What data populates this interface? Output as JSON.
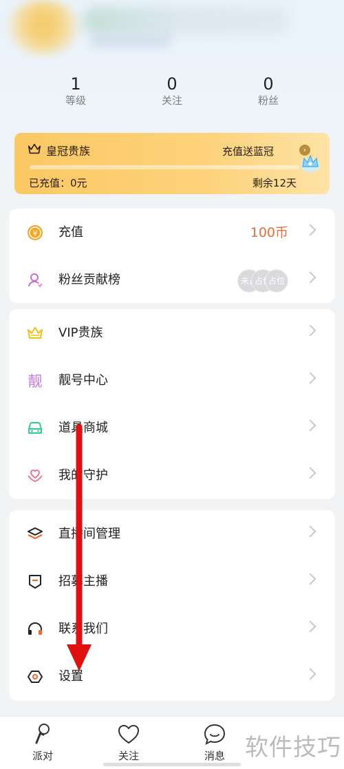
{
  "stats": [
    {
      "value": "1",
      "label": "等级"
    },
    {
      "value": "0",
      "label": "关注"
    },
    {
      "value": "0",
      "label": "粉丝"
    }
  ],
  "vip_card": {
    "title": "皇冠贵族",
    "promo": "充值送蓝冠",
    "paid": "已充值：0元",
    "remaining": "剩余12天",
    "progress": 0
  },
  "menu_group_1": [
    {
      "label": "充值",
      "value": "100币",
      "icon": "yen-coin-icon"
    },
    {
      "label": "粉丝贡献榜",
      "icon": "fan-user-icon",
      "avatar_texts": [
        "未占",
        "占位",
        "占位"
      ]
    }
  ],
  "menu_group_2": [
    {
      "label": "VIP贵族",
      "icon": "crown-icon"
    },
    {
      "label": "靓号中心",
      "icon": "liang-char-icon",
      "icon_text": "靓"
    },
    {
      "label": "道具商城",
      "icon": "car-icon"
    },
    {
      "label": "我的守护",
      "icon": "heart-hands-icon"
    }
  ],
  "menu_group_3": [
    {
      "label": "直播间管理",
      "icon": "layers-icon"
    },
    {
      "label": "招募主播",
      "icon": "badge-icon"
    },
    {
      "label": "联系我们",
      "icon": "headphones-icon"
    },
    {
      "label": "设置",
      "icon": "hex-nut-icon"
    }
  ],
  "tabbar": [
    {
      "label": "派对",
      "icon": "microphone-icon"
    },
    {
      "label": "关注",
      "icon": "heart-icon"
    },
    {
      "label": "消息",
      "icon": "chat-smile-icon"
    }
  ],
  "watermark": "软件技巧",
  "colors": {
    "accent_orange": "#e8703a",
    "vip_gold": "#fbc964",
    "arrow_red": "#e01010"
  }
}
